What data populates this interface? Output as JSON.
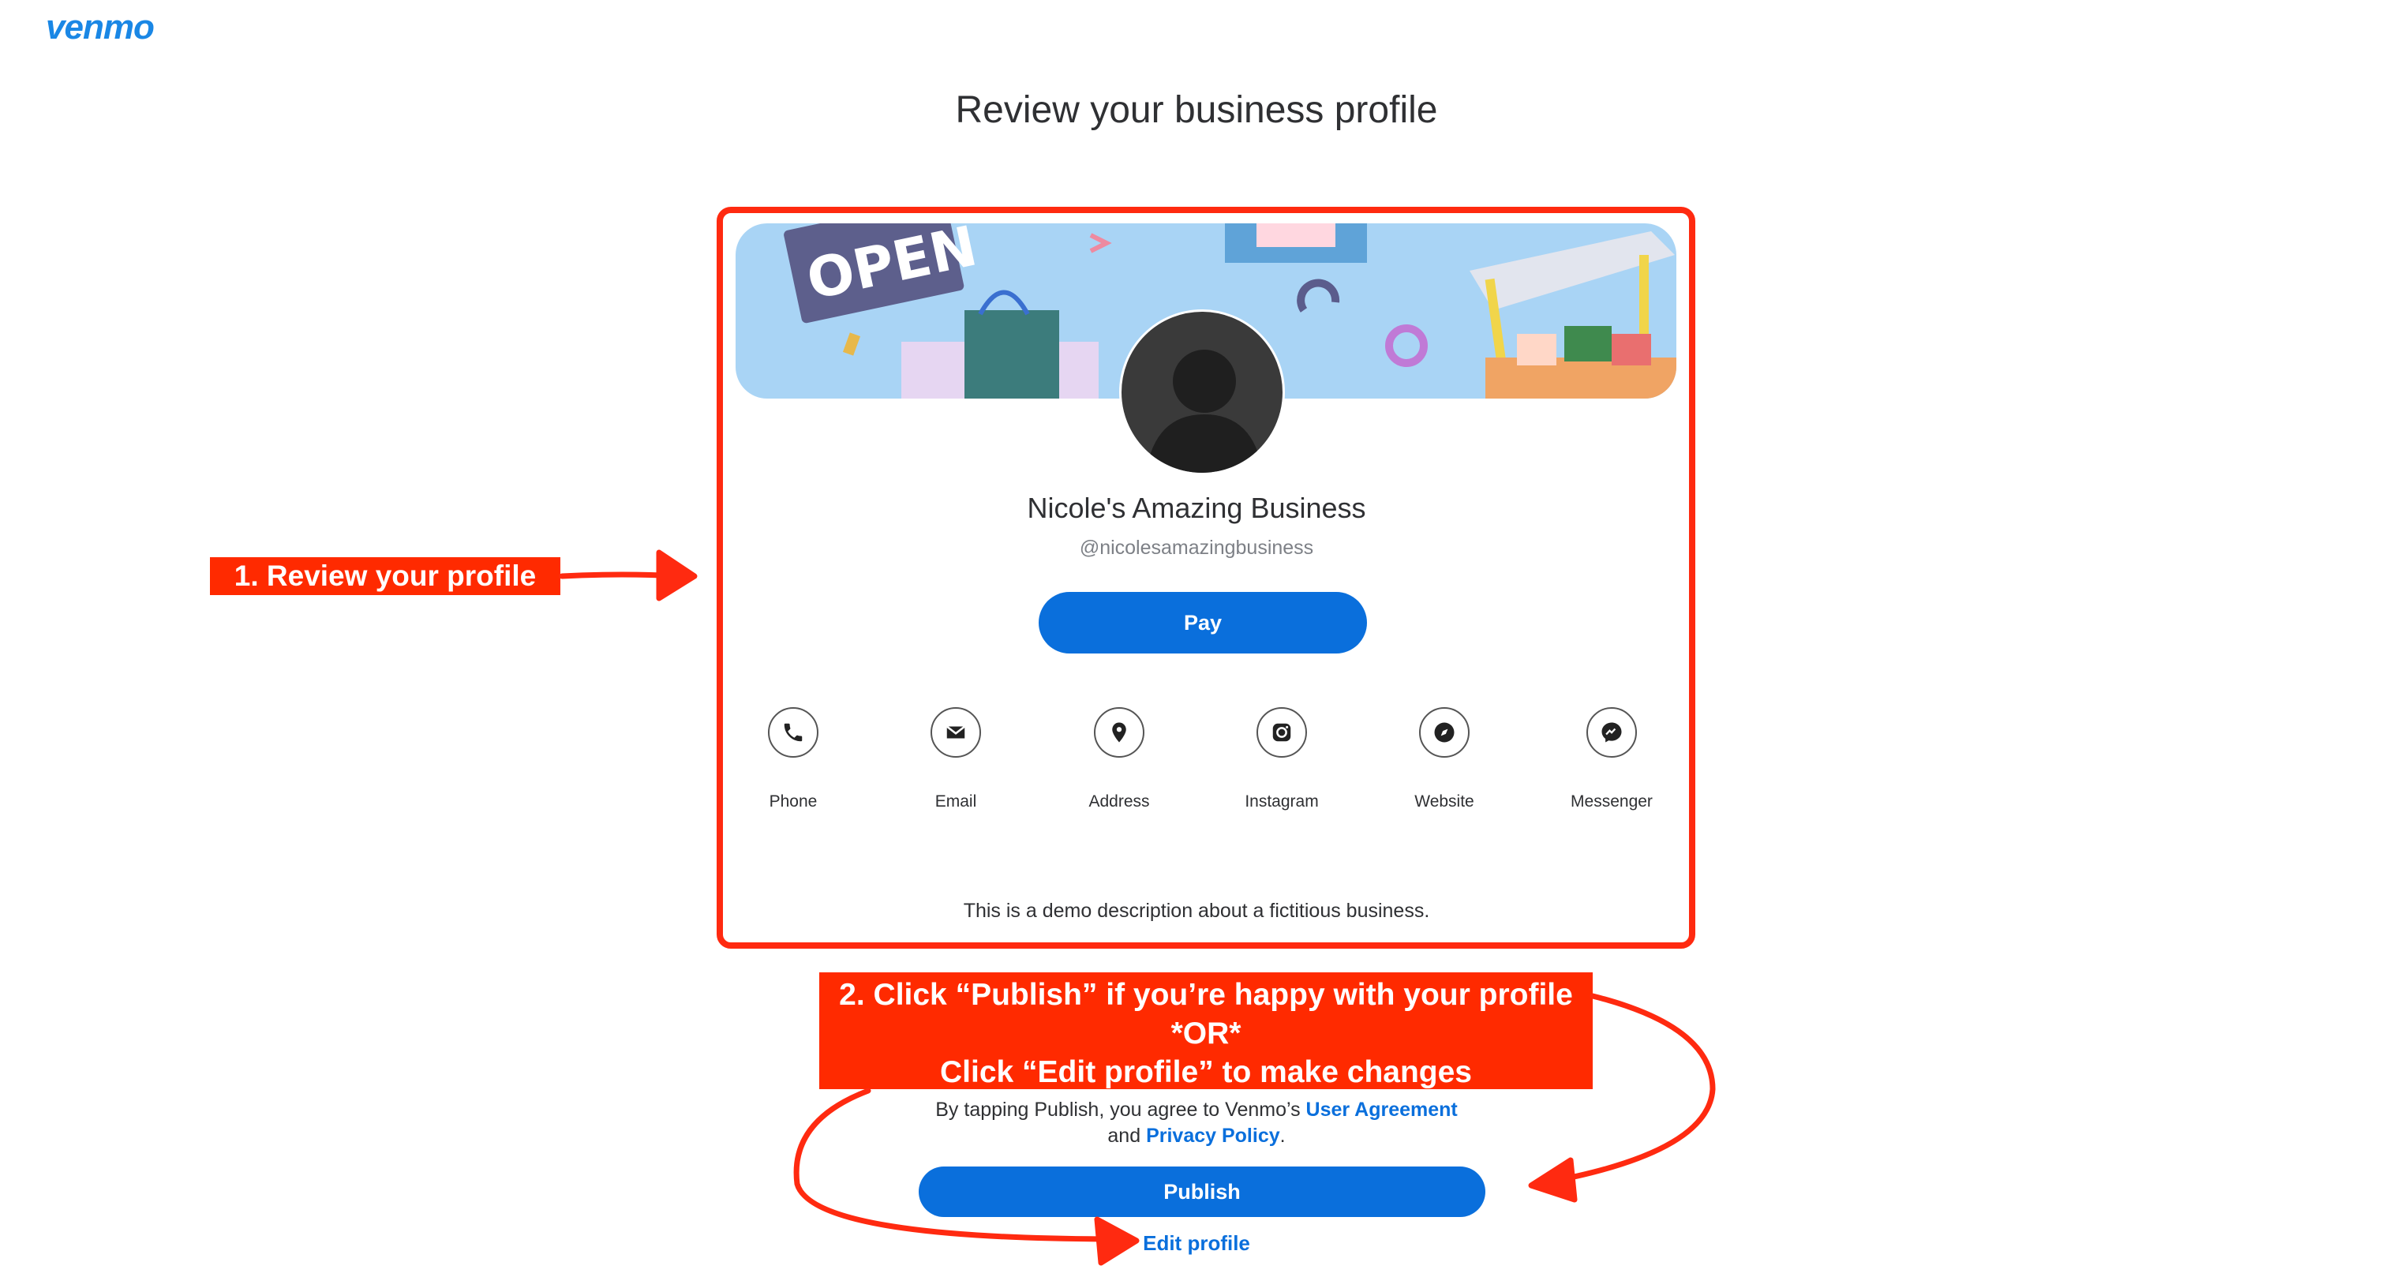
{
  "brand": {
    "logo_text": "venmo",
    "accent": "#0a6fdc",
    "annotation_color": "#ff2a00"
  },
  "page": {
    "title": "Review your business profile"
  },
  "profile": {
    "banner_sign_text": "OPEN",
    "business_name": "Nicole's Amazing Business",
    "handle": "@nicolesamazingbusiness",
    "pay_label": "Pay",
    "description": "This is a demo description about a fictitious business.",
    "contacts": [
      {
        "label": "Phone",
        "icon": "phone-icon"
      },
      {
        "label": "Email",
        "icon": "email-icon"
      },
      {
        "label": "Address",
        "icon": "location-pin-icon"
      },
      {
        "label": "Instagram",
        "icon": "instagram-icon"
      },
      {
        "label": "Website",
        "icon": "compass-icon"
      },
      {
        "label": "Messenger",
        "icon": "messenger-icon"
      }
    ]
  },
  "annotations": {
    "step1": "1. Review your profile",
    "step2_line1": "2. Click “Publish” if you’re happy with your profile",
    "step2_line2": "*OR*",
    "step2_line3": "Click “Edit profile” to make changes"
  },
  "footer": {
    "agreement_prefix": "By tapping Publish, you agree to Venmo’s",
    "user_agreement_link": "User Agreement",
    "agreement_and": "and",
    "privacy_link": "Privacy Policy",
    "agreement_suffix": ".",
    "publish_label": "Publish",
    "edit_label": "Edit profile"
  }
}
